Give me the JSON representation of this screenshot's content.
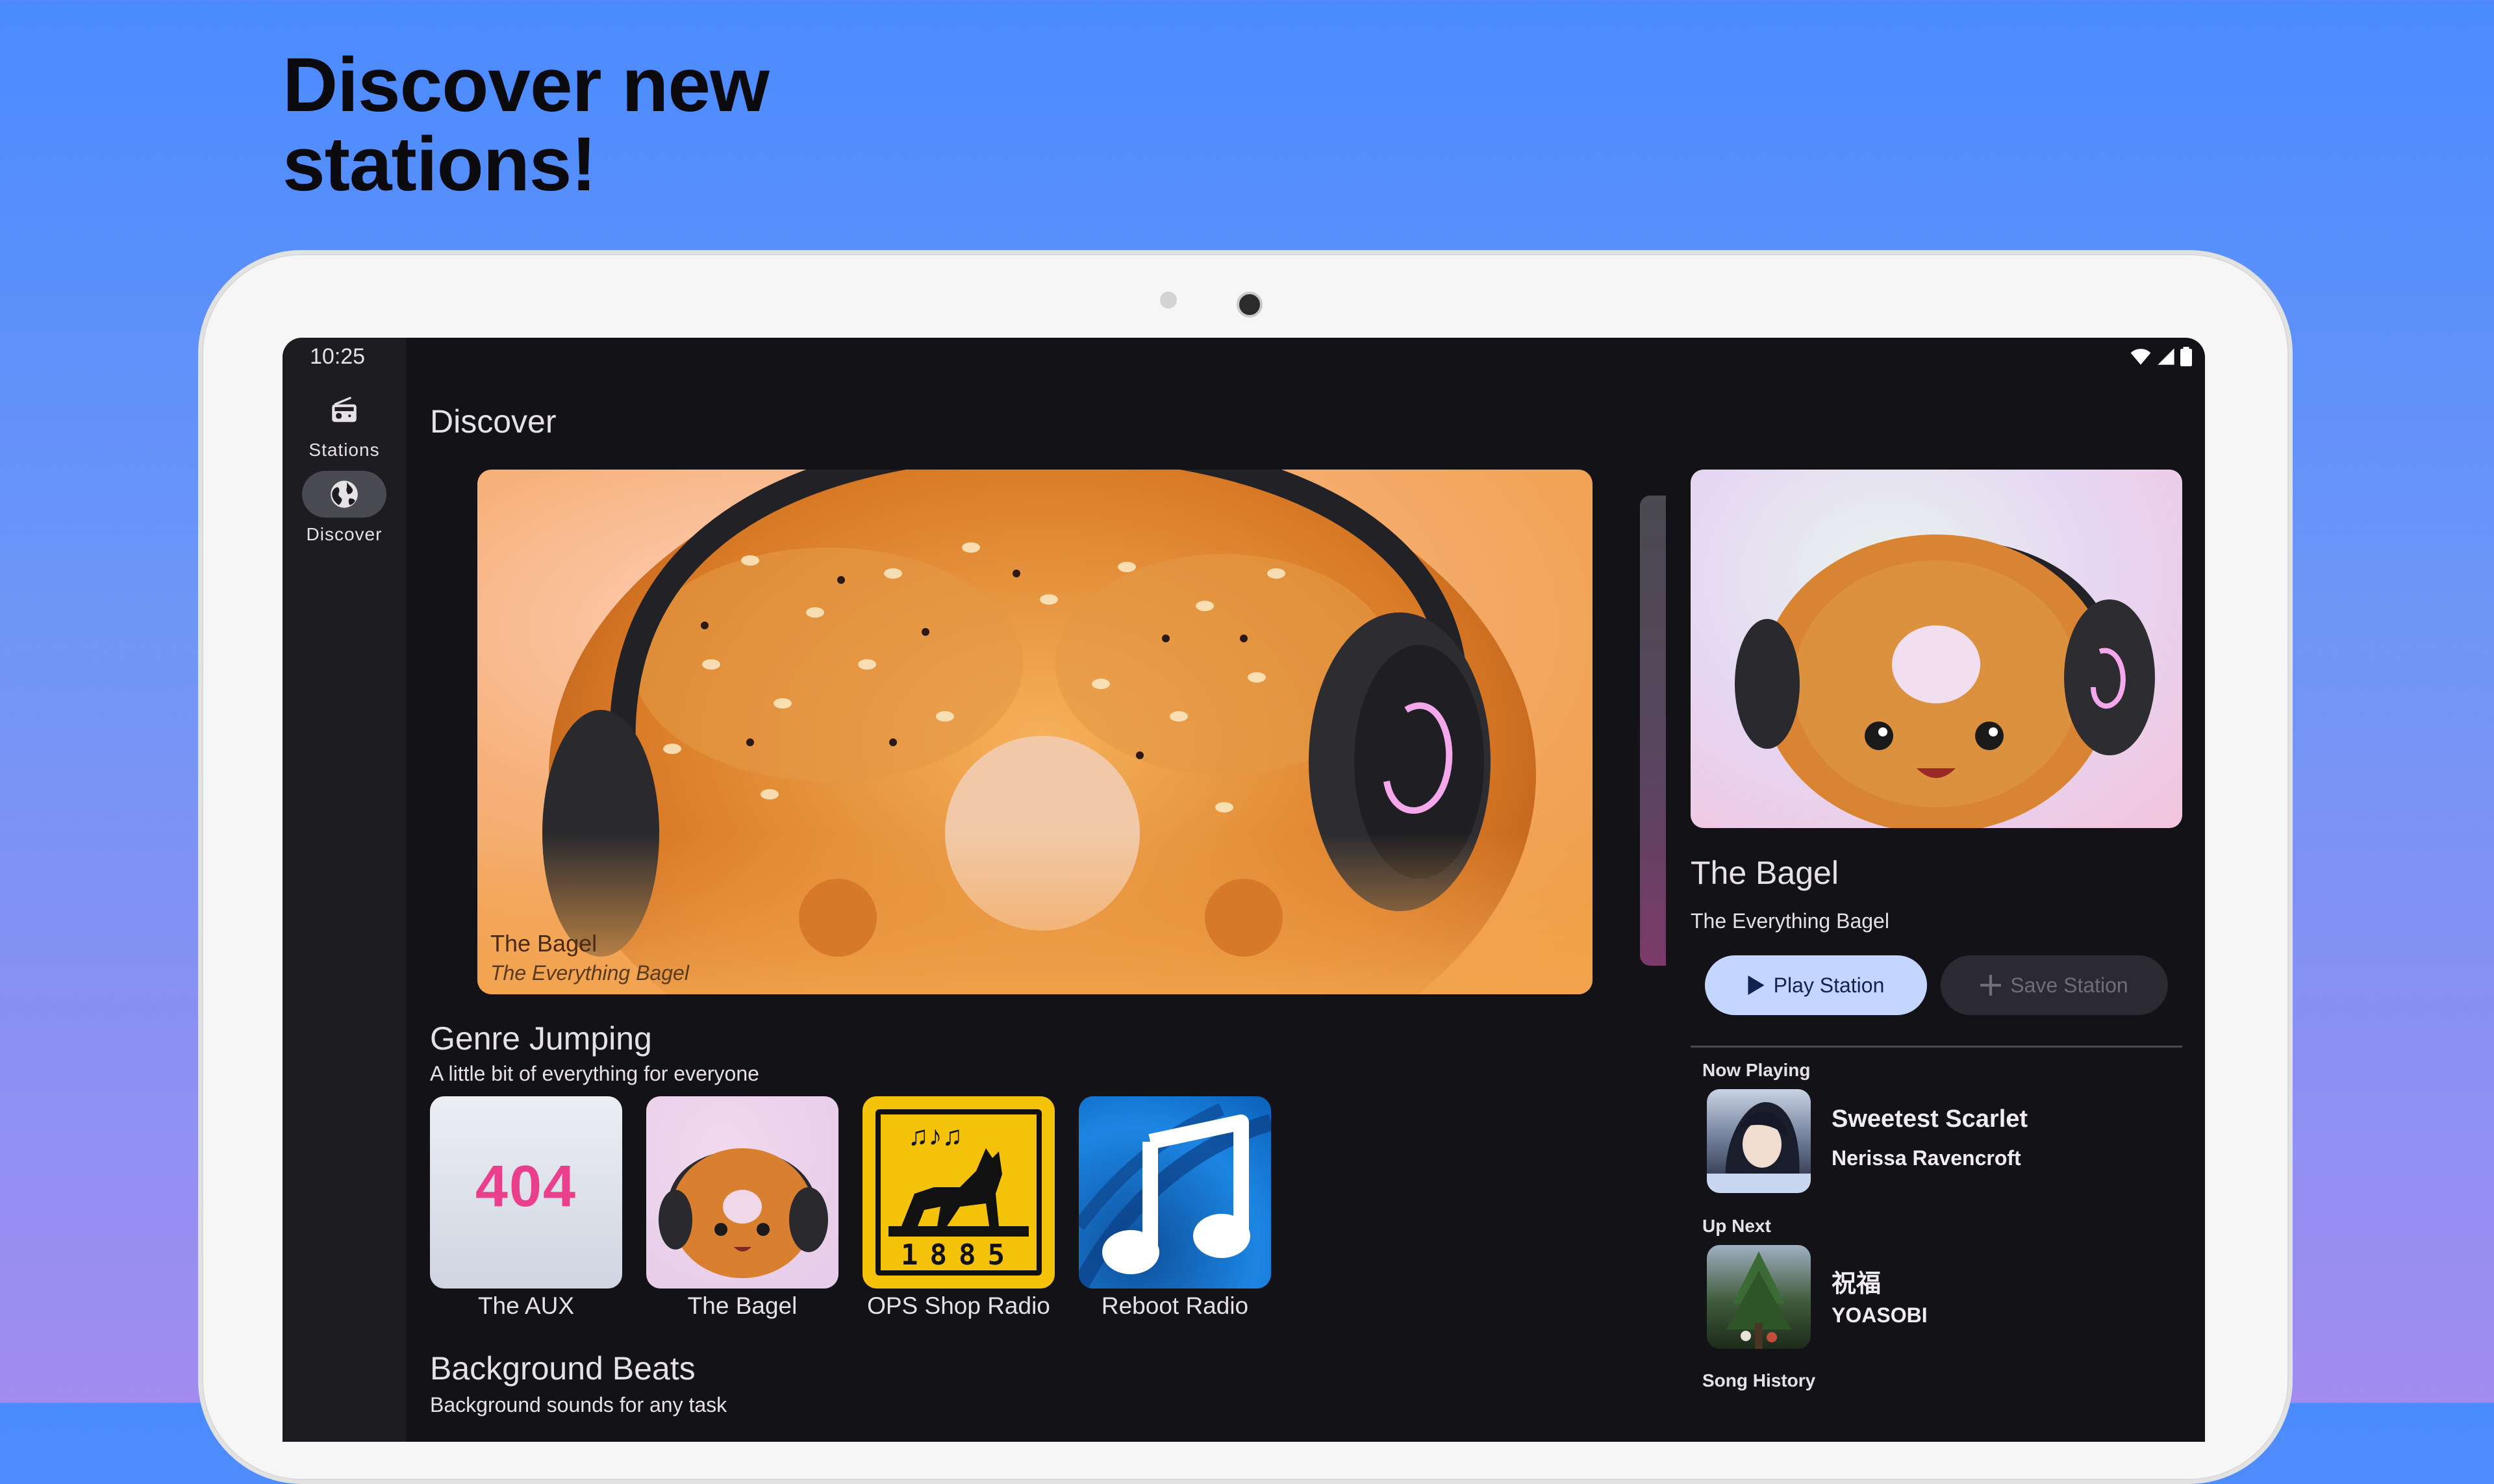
{
  "headline": {
    "line1": "Discover new",
    "line2": "stations!"
  },
  "status_bar": {
    "time": "10:25",
    "icons": [
      "wifi-icon",
      "signal-icon",
      "battery-icon"
    ]
  },
  "nav": {
    "items": [
      {
        "label": "Stations",
        "icon": "radio-icon",
        "active": false
      },
      {
        "label": "Discover",
        "icon": "globe-icon",
        "active": true
      }
    ]
  },
  "main": {
    "title": "Discover",
    "hero": {
      "title": "The Bagel",
      "subtitle": "The Everything Bagel"
    },
    "sections": [
      {
        "title": "Genre Jumping",
        "subtitle": "A little bit of everything for everyone",
        "stations": [
          {
            "name": "The AUX",
            "art_text": "404"
          },
          {
            "name": "The Bagel"
          },
          {
            "name": "OPS Shop Radio",
            "art_text": "1885"
          },
          {
            "name": "Reboot Radio"
          }
        ]
      },
      {
        "title": "Background Beats",
        "subtitle": "Background sounds for any task"
      }
    ]
  },
  "detail": {
    "station_title": "The Bagel",
    "station_subtitle": "The Everything Bagel",
    "play_label": "Play Station",
    "save_label": "Save Station",
    "now_playing_label": "Now Playing",
    "now_playing": {
      "title": "Sweetest Scarlet",
      "artist": "Nerissa Ravencroft"
    },
    "up_next_label": "Up Next",
    "up_next": {
      "title": "祝福",
      "artist": "YOASOBI"
    },
    "history_label": "Song History"
  },
  "colors": {
    "background_top": "#4a8bff",
    "background_bottom": "#a28cf0",
    "screen_bg": "#131317",
    "play_button": "#c4d5ff",
    "aux_pink": "#ea3f8c",
    "ops_yellow": "#f5c20a",
    "reboot_blue": "#1c86e3"
  }
}
